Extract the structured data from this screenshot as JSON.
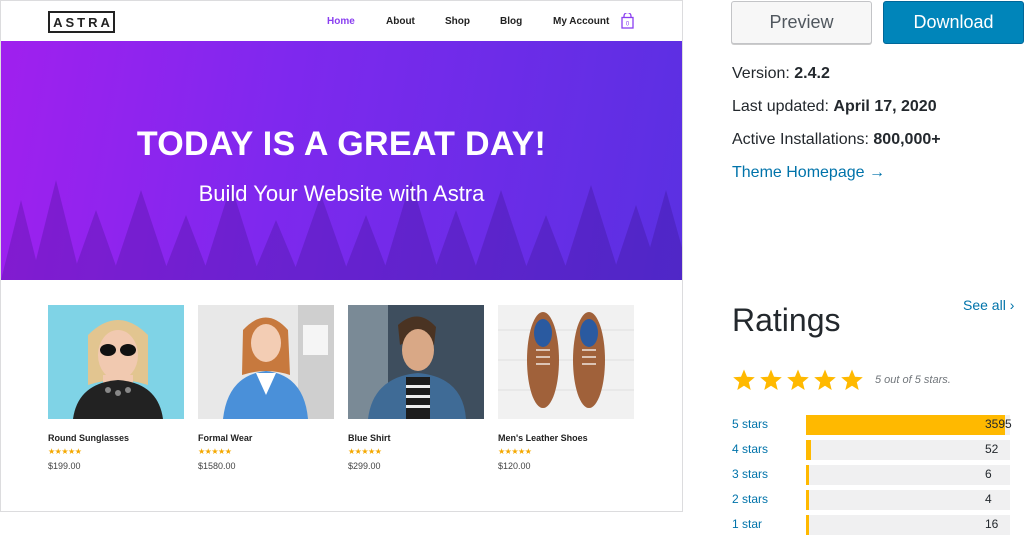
{
  "site": {
    "logo": "ASTRA",
    "nav": [
      "Home",
      "About",
      "Shop",
      "Blog",
      "My Account"
    ],
    "hero_title": "TODAY IS A GREAT DAY!",
    "hero_subtitle": "Build Your Website with Astra",
    "products": [
      {
        "name": "Round Sunglasses",
        "stars": "★★★★★",
        "price": "$199.00"
      },
      {
        "name": "Formal Wear",
        "stars": "★★★★★",
        "price": "$1580.00"
      },
      {
        "name": "Blue Shirt",
        "stars": "★★★★★",
        "price": "$299.00"
      },
      {
        "name": "Men's Leather Shoes",
        "stars": "★★★★★",
        "price": "$120.00"
      }
    ]
  },
  "actions": {
    "preview": "Preview",
    "download": "Download"
  },
  "meta": {
    "version_label": "Version: ",
    "version": "2.4.2",
    "updated_label": "Last updated: ",
    "updated": "April 17, 2020",
    "installs_label": "Active Installations: ",
    "installs": "800,000+",
    "homepage": "Theme Homepage →"
  },
  "ratings": {
    "title": "Ratings",
    "see_all": "See all ›",
    "summary": "5 out of 5 stars.",
    "rating_value": 5,
    "breakdown": [
      {
        "label": "5 stars",
        "count": "3595",
        "fraction": 0.974
      },
      {
        "label": "4 stars",
        "count": "52",
        "fraction": 0.014
      },
      {
        "label": "3 stars",
        "count": "6",
        "fraction": 0.002
      },
      {
        "label": "2 stars",
        "count": "4",
        "fraction": 0.001
      },
      {
        "label": "1 star",
        "count": "16",
        "fraction": 0.004
      }
    ]
  },
  "colors": {
    "accent": "#0085ba",
    "link": "#0073aa",
    "star": "#ffb900",
    "hero_start": "#a020ee",
    "hero_end": "#5a30e2",
    "nav_active": "#8a3ff0"
  },
  "icons": {
    "cart": "shopping-bag-icon",
    "star": "star-icon",
    "trees": "forest-silhouette"
  }
}
